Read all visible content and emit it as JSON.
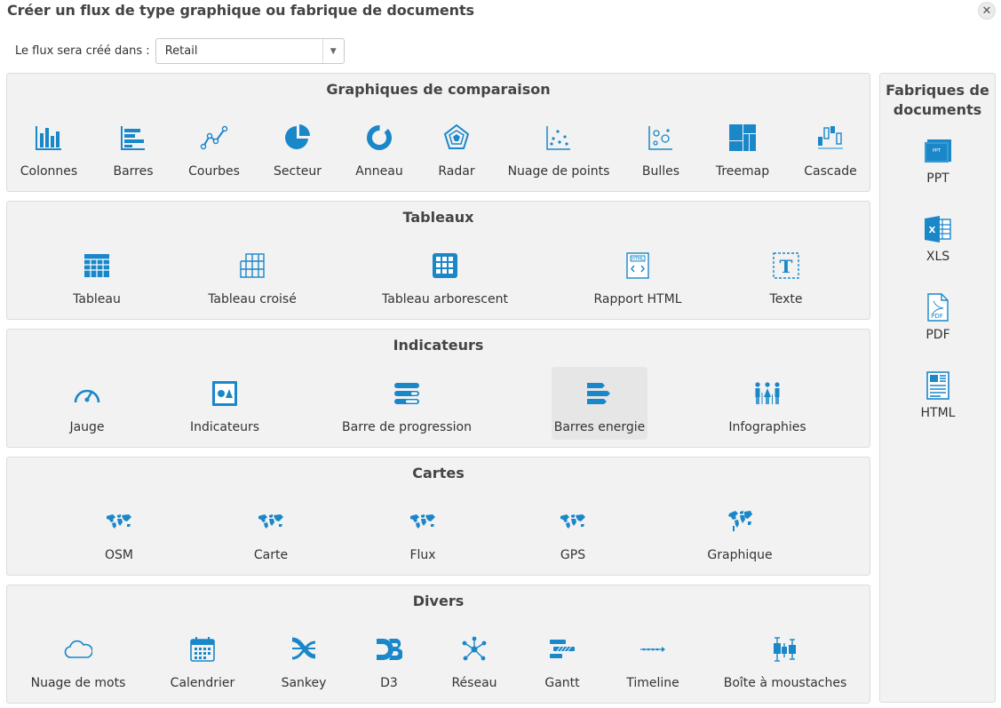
{
  "dialog": {
    "title": "Créer un flux de type graphique ou fabrique de documents",
    "close_glyph": "✕"
  },
  "target": {
    "label": "Le flux sera créé dans :",
    "value": "Retail",
    "arrow_glyph": "▼"
  },
  "colors": {
    "accent": "#1a87c9",
    "panel_bg": "#f2f2f2",
    "selected_bg": "#e6e6e6"
  },
  "sections": {
    "comparison": {
      "title": "Graphiques de comparaison",
      "items": [
        {
          "label": "Colonnes",
          "icon": "column-chart-icon"
        },
        {
          "label": "Barres",
          "icon": "bar-chart-icon"
        },
        {
          "label": "Courbes",
          "icon": "line-chart-icon"
        },
        {
          "label": "Secteur",
          "icon": "pie-chart-icon"
        },
        {
          "label": "Anneau",
          "icon": "donut-chart-icon"
        },
        {
          "label": "Radar",
          "icon": "radar-chart-icon"
        },
        {
          "label": "Nuage de points",
          "icon": "scatter-chart-icon"
        },
        {
          "label": "Bulles",
          "icon": "bubble-chart-icon"
        },
        {
          "label": "Treemap",
          "icon": "treemap-icon"
        },
        {
          "label": "Cascade",
          "icon": "waterfall-chart-icon"
        }
      ]
    },
    "tables": {
      "title": "Tableaux",
      "items": [
        {
          "label": "Tableau",
          "icon": "table-icon"
        },
        {
          "label": "Tableau croisé",
          "icon": "pivot-table-icon"
        },
        {
          "label": "Tableau arborescent",
          "icon": "tree-table-icon"
        },
        {
          "label": "Rapport HTML",
          "icon": "html-report-icon"
        },
        {
          "label": "Texte",
          "icon": "text-icon"
        }
      ]
    },
    "indicators": {
      "title": "Indicateurs",
      "items": [
        {
          "label": "Jauge",
          "icon": "gauge-icon"
        },
        {
          "label": "Indicateurs",
          "icon": "kpi-icon"
        },
        {
          "label": "Barre de progression",
          "icon": "progress-bar-icon"
        },
        {
          "label": "Barres energie",
          "icon": "energy-bars-icon",
          "selected": true
        },
        {
          "label": "Infographies",
          "icon": "infographics-icon"
        }
      ]
    },
    "maps": {
      "title": "Cartes",
      "items": [
        {
          "label": "OSM",
          "icon": "world-map-icon"
        },
        {
          "label": "Carte",
          "icon": "world-map-icon"
        },
        {
          "label": "Flux",
          "icon": "world-map-icon"
        },
        {
          "label": "GPS",
          "icon": "world-map-icon"
        },
        {
          "label": "Graphique",
          "icon": "globe-icon"
        }
      ]
    },
    "misc": {
      "title": "Divers",
      "items": [
        {
          "label": "Nuage de mots",
          "icon": "cloud-icon"
        },
        {
          "label": "Calendrier",
          "icon": "calendar-icon"
        },
        {
          "label": "Sankey",
          "icon": "sankey-icon"
        },
        {
          "label": "D3",
          "icon": "d3-icon"
        },
        {
          "label": "Réseau",
          "icon": "network-icon"
        },
        {
          "label": "Gantt",
          "icon": "gantt-icon"
        },
        {
          "label": "Timeline",
          "icon": "timeline-icon"
        },
        {
          "label": "Boîte à moustaches",
          "icon": "boxplot-icon"
        }
      ]
    }
  },
  "factories": {
    "title_line1": "Fabriques de",
    "title_line2": "documents",
    "items": [
      {
        "label": "PPT",
        "icon": "ppt-file-icon",
        "badge": "PPT"
      },
      {
        "label": "XLS",
        "icon": "xls-file-icon",
        "badge": "X"
      },
      {
        "label": "PDF",
        "icon": "pdf-file-icon",
        "badge": "PDF"
      },
      {
        "label": "HTML",
        "icon": "html-file-icon"
      }
    ]
  }
}
